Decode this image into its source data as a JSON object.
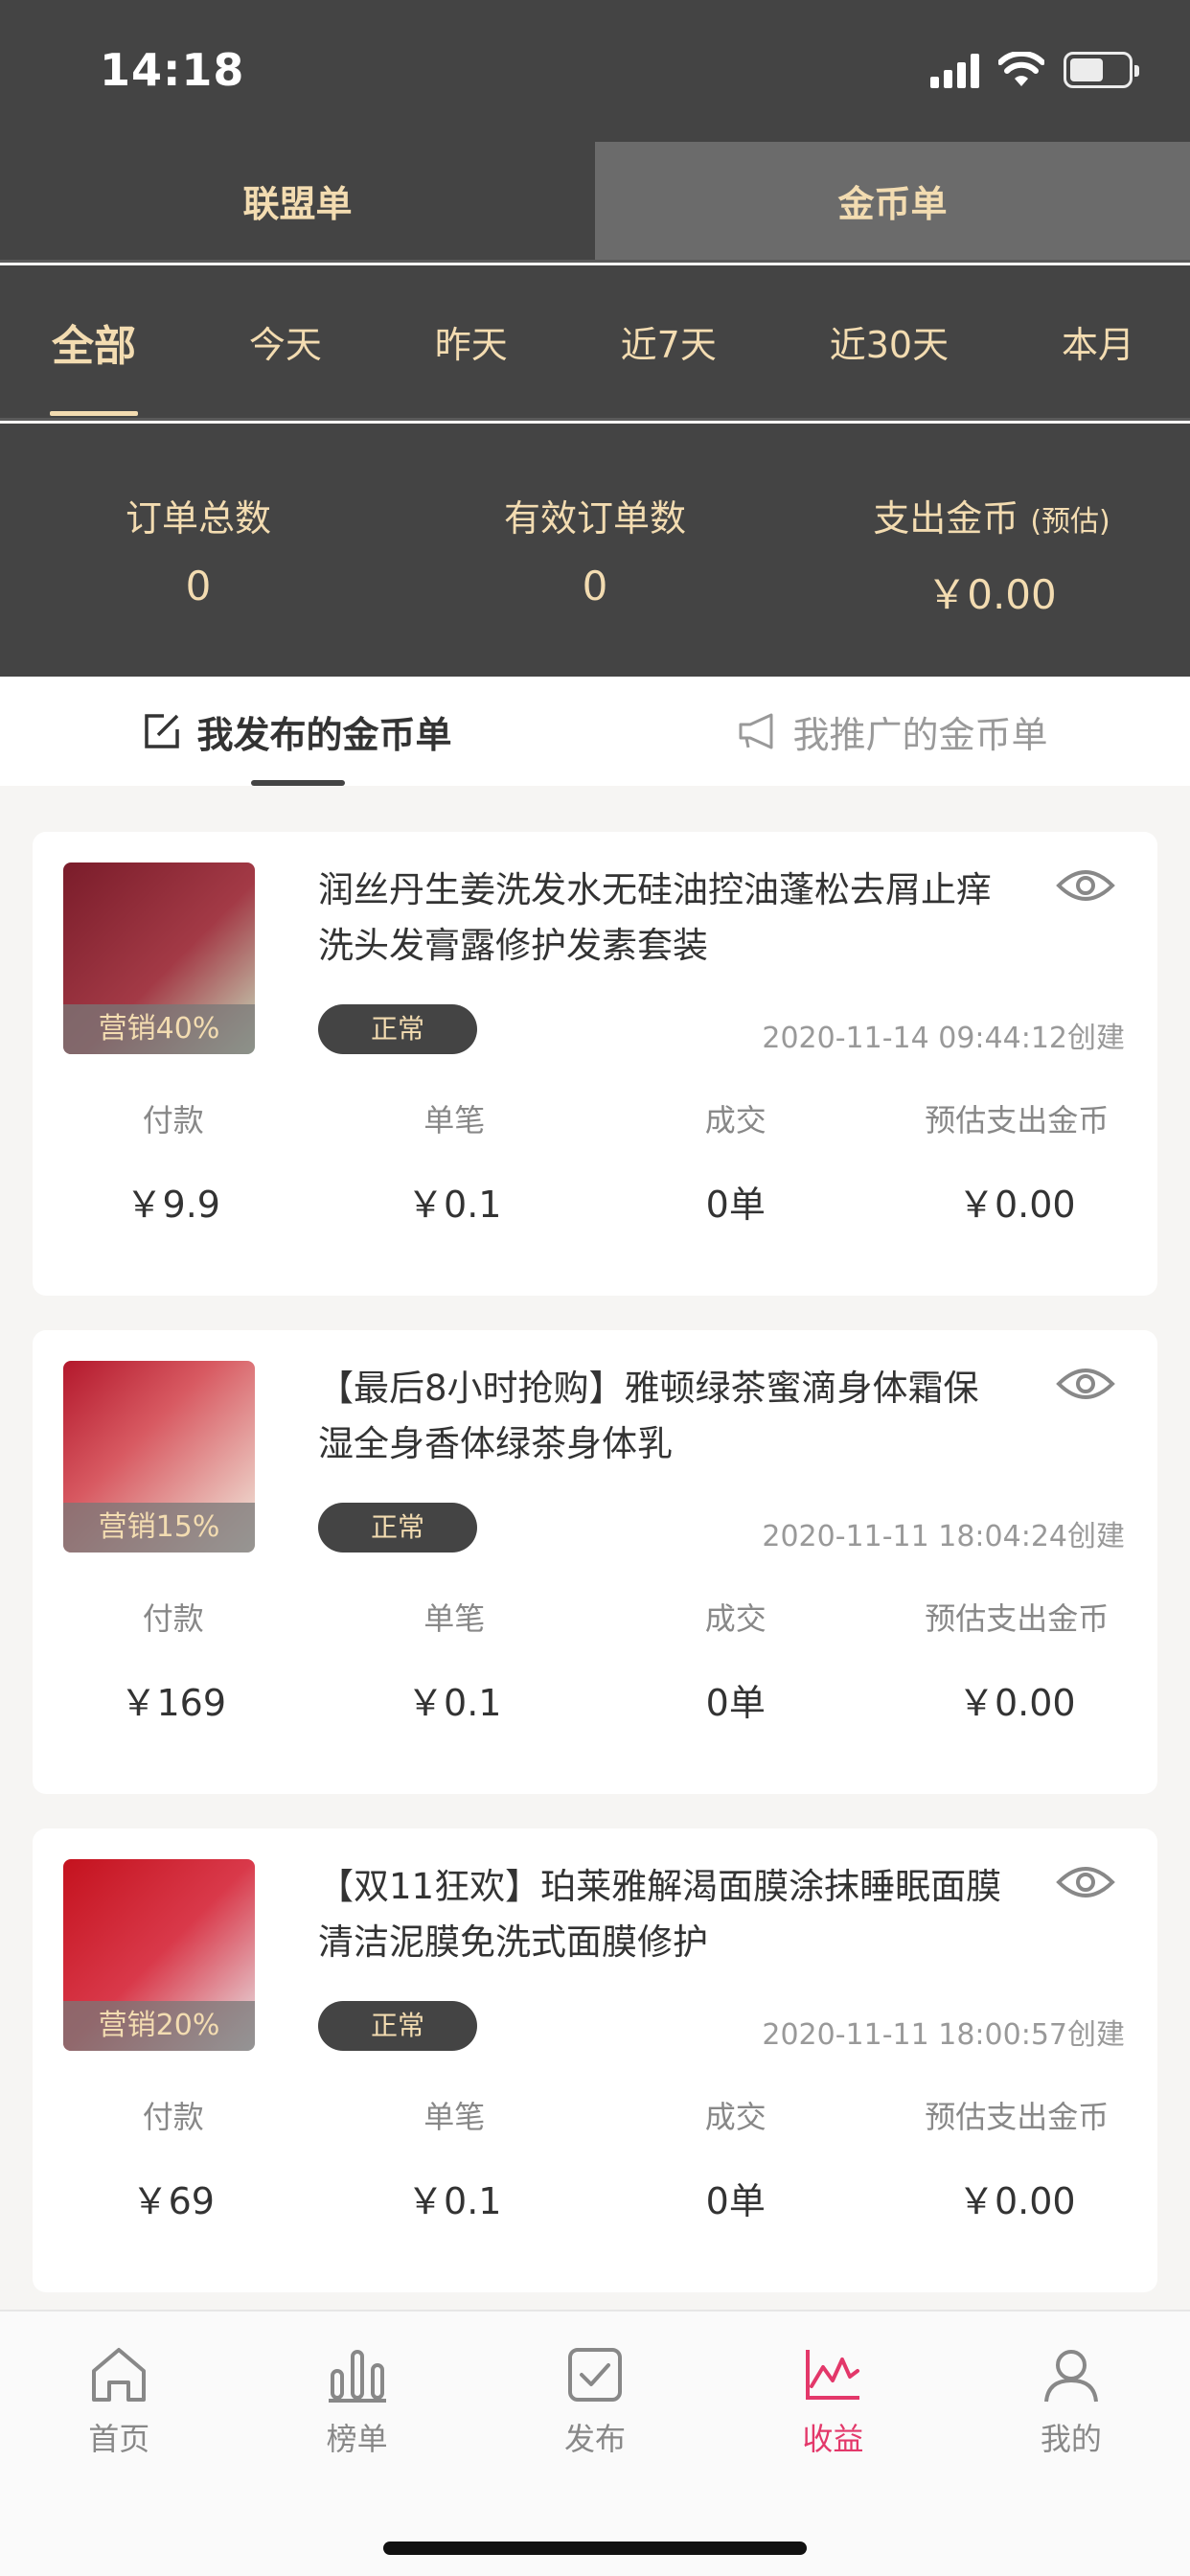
{
  "status_bar": {
    "time": "14:18"
  },
  "type_tabs": [
    {
      "label": "联盟单",
      "active": false
    },
    {
      "label": "金币单",
      "active": true
    }
  ],
  "period_tabs": [
    {
      "label": "全部",
      "active": true
    },
    {
      "label": "今天"
    },
    {
      "label": "昨天"
    },
    {
      "label": "近7天"
    },
    {
      "label": "近30天"
    },
    {
      "label": "本月"
    }
  ],
  "summary": {
    "total_orders_label": "订单总数",
    "total_orders_value": "0",
    "valid_orders_label": "有效订单数",
    "valid_orders_value": "0",
    "coin_expense_label": "支出金币",
    "coin_expense_note": "(预估)",
    "coin_expense_value": "￥0.00"
  },
  "sub_tabs": [
    {
      "label": "我发布的金币单",
      "icon": "edit-icon",
      "active": true
    },
    {
      "label": "我推广的金币单",
      "icon": "megaphone-icon",
      "active": false
    }
  ],
  "stat_labels": {
    "pay": "付款",
    "single": "单笔",
    "deal": "成交",
    "coin": "预估支出金币"
  },
  "orders": [
    {
      "title": "润丝丹生姜洗发水无硅油控油蓬松去屑止痒洗头发膏露修护发素套装",
      "promo": "营销40%",
      "status": "正常",
      "created": "2020-11-14 09:44:12创建",
      "pay": "￥9.9",
      "single": "￥0.1",
      "deal": "0单",
      "coin": "￥0.00",
      "thumb_colors": [
        "#7a1c2a",
        "#c9e0c0"
      ]
    },
    {
      "title": "【最后8小时抢购】雅顿绿茶蜜滴身体霜保湿全身香体绿茶身体乳",
      "promo": "营销15%",
      "status": "正常",
      "created": "2020-11-11 18:04:24创建",
      "pay": "￥169",
      "single": "￥0.1",
      "deal": "0单",
      "coin": "￥0.00",
      "thumb_colors": [
        "#b3182c",
        "#f2ede0"
      ]
    },
    {
      "title": "【双11狂欢】珀莱雅解渴面膜涂抹睡眠面膜清洁泥膜免洗式面膜修护",
      "promo": "营销20%",
      "status": "正常",
      "created": "2020-11-11 18:00:57创建",
      "pay": "￥69",
      "single": "￥0.1",
      "deal": "0单",
      "coin": "￥0.00",
      "thumb_colors": [
        "#c4121e",
        "#e8e8ea"
      ]
    }
  ],
  "bottom_nav": [
    {
      "label": "首页",
      "icon": "home-icon"
    },
    {
      "label": "榜单",
      "icon": "chart-bars-icon"
    },
    {
      "label": "发布",
      "icon": "publish-check-icon"
    },
    {
      "label": "收益",
      "icon": "earnings-icon",
      "active": true
    },
    {
      "label": "我的",
      "icon": "user-icon"
    }
  ],
  "colors": {
    "header_bg": "#444444",
    "gold_text": "#f3dcb1",
    "accent": "#e3386a"
  }
}
